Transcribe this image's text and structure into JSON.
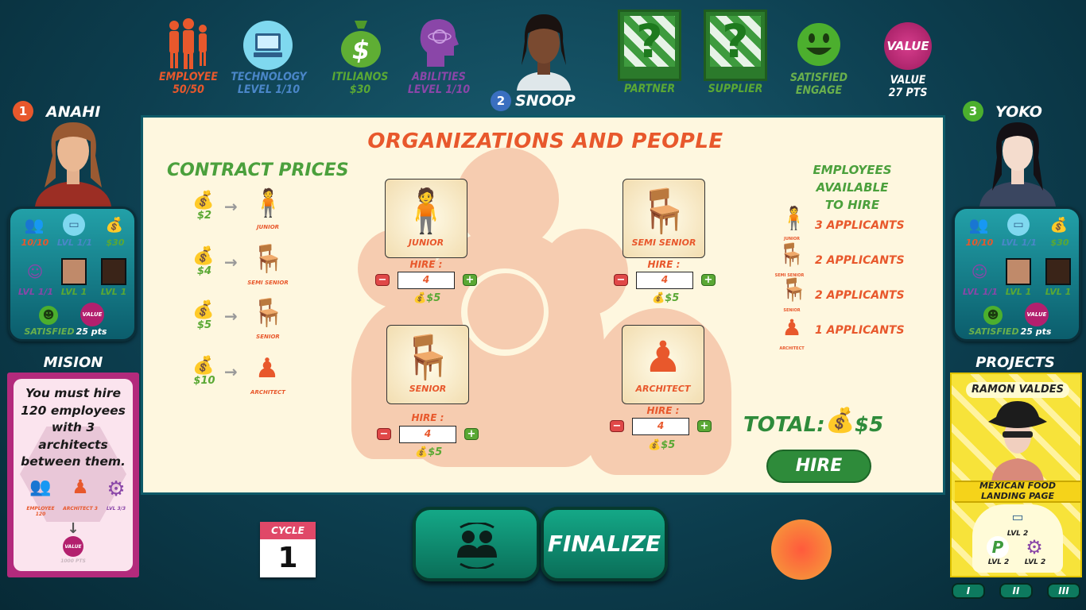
{
  "top_bar": {
    "employee": {
      "label": "EMPLOYEE",
      "value": "50/50"
    },
    "technology": {
      "label": "TECHNOLOGY",
      "value": "LEVEL  1/10"
    },
    "currency": {
      "label": "ITILIANOS",
      "value": "$30"
    },
    "abilities": {
      "label": "ABILITIES",
      "value": "LEVEL  1/10"
    },
    "current_player": {
      "number": "2",
      "name": "SNOOP"
    },
    "partner": {
      "label": "PARTNER",
      "symbol": "?"
    },
    "supplier": {
      "label": "SUPPLIER",
      "symbol": "?"
    },
    "satisfied": {
      "label": "SATISFIED",
      "sublabel": "ENGAGE"
    },
    "value": {
      "icon_text": "VALUE",
      "label": "VALUE",
      "points": "27 PTS"
    }
  },
  "players": {
    "left": {
      "number": "1",
      "name": "ANAHI",
      "employees": "10/10",
      "tech": "LVL 1/1",
      "money": "$30",
      "ability": "LVL 1/1",
      "partner_lvl": "LVL 1",
      "supplier_lvl": "LVL 1",
      "satisfied": "SATISFIED",
      "value_icon": "VALUE",
      "points": "25 pts"
    },
    "right": {
      "number": "3",
      "name": "YOKO",
      "employees": "10/10",
      "tech": "LVL 1/1",
      "money": "$30",
      "ability": "LVL 1/1",
      "partner_lvl": "LVL 1",
      "supplier_lvl": "LVL 1",
      "satisfied": "SATISFIED",
      "value_icon": "VALUE",
      "points": "25 pts"
    }
  },
  "mision": {
    "heading": "MISION",
    "text": "You must hire 120 employees with 3 architects between them.",
    "icon_labels": [
      "EMPLOYEE 120",
      "ARCHITECT 3",
      "LVL 3/3"
    ],
    "value_icon": "VALUE",
    "value_pts": "1000 PTS"
  },
  "panel": {
    "title": "ORGANIZATIONS AND PEOPLE",
    "contract_heading": "CONTRACT PRICES",
    "prices": [
      {
        "price": "$2",
        "role": "JUNIOR"
      },
      {
        "price": "$4",
        "role": "SEMI SENIOR"
      },
      {
        "price": "$5",
        "role": "SENIOR"
      },
      {
        "price": "$10",
        "role": "ARCHITECT"
      }
    ],
    "hire_cards": [
      {
        "role": "JUNIOR",
        "hire_label": "HIRE :",
        "qty": "4",
        "cost": "$5"
      },
      {
        "role": "SEMI SENIOR",
        "hire_label": "HIRE :",
        "qty": "4",
        "cost": "$5"
      },
      {
        "role": "SENIOR",
        "hire_label": "HIRE :",
        "qty": "4",
        "cost": "$5"
      },
      {
        "role": "ARCHITECT",
        "hire_label": "HIRE :",
        "qty": "4",
        "cost": "$5"
      }
    ],
    "employees_heading_1": "EMPLOYEES AVAILABLE",
    "employees_heading_2": "TO HIRE",
    "applicants": [
      {
        "text": "3  APPLICANTS",
        "role": "JUNIOR"
      },
      {
        "text": "2 APPLICANTS",
        "role": "SEMI SENIOR"
      },
      {
        "text": "2 APPLICANTS",
        "role": "SENIOR"
      },
      {
        "text": "1 APPLICANTS",
        "role": "ARCHITECT"
      }
    ],
    "total_label": "TOTAL:",
    "total_value": "$5",
    "hire_button": "HIRE"
  },
  "bottom": {
    "cycle_label": "CYCLE",
    "cycle_value": "1",
    "finalize_label": "FINALIZE"
  },
  "projects": {
    "heading": "PROJECTS",
    "client": "RAMON VALDES",
    "project_name_1": "MEXICAN FOOD",
    "project_name_2": "LANDING PAGE",
    "req_tech": "LVL 2",
    "req_partner_symbol": "P",
    "req_partner": "LVL 2",
    "req_ability": "LVL 2",
    "pages": [
      "I",
      "II",
      "III"
    ]
  },
  "colors": {
    "orange": "#e8582c",
    "green": "#5aa834",
    "blue": "#4a86c8",
    "purple": "#8a46a8",
    "panel_bg": "#fef7df"
  }
}
